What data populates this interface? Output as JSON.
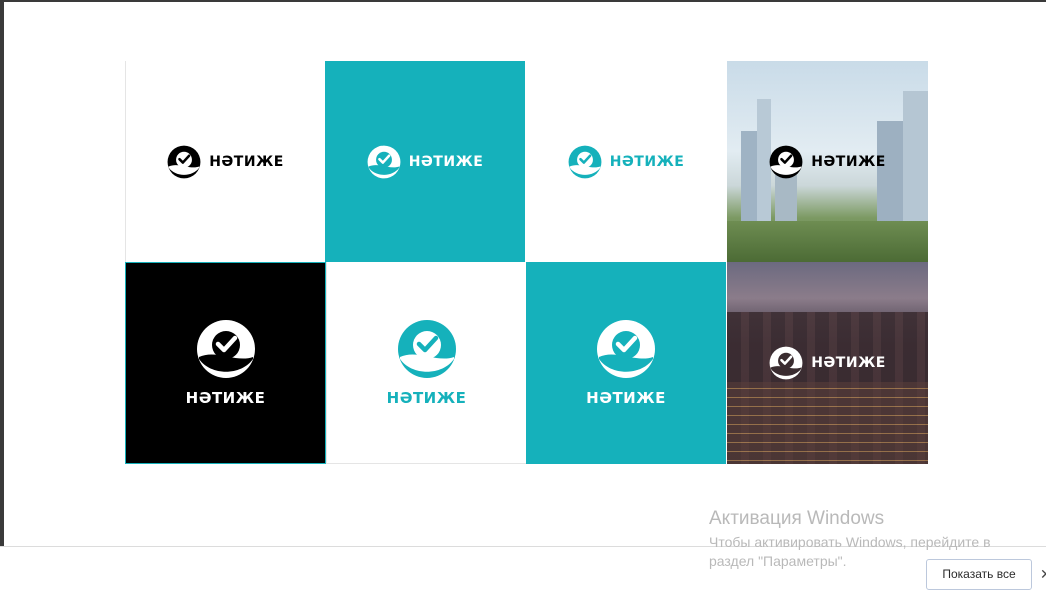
{
  "brand": {
    "wordmark": "НӘТИЖЕ",
    "colors": {
      "teal": "#15b1bb",
      "black": "#000000",
      "white": "#ffffff"
    }
  },
  "tiles": [
    {
      "background": "white",
      "mark_color": "black",
      "layout": "horizontal"
    },
    {
      "background": "teal",
      "mark_color": "white",
      "layout": "horizontal"
    },
    {
      "background": "white",
      "mark_color": "teal",
      "layout": "horizontal"
    },
    {
      "background": "city-photo-day",
      "mark_color": "black",
      "layout": "horizontal"
    },
    {
      "background": "black",
      "mark_color": "white",
      "layout": "vertical"
    },
    {
      "background": "white",
      "mark_color": "teal",
      "layout": "vertical"
    },
    {
      "background": "teal",
      "mark_color": "white",
      "layout": "vertical"
    },
    {
      "background": "city-photo-night",
      "mark_color": "white",
      "layout": "horizontal"
    }
  ],
  "activation": {
    "title": "Активация Windows",
    "subtitle": "Чтобы активировать Windows, перейдите в раздел \"Параметры\"."
  },
  "download_bar": {
    "show_all_label": "Показать все",
    "close_icon": "close-icon"
  }
}
